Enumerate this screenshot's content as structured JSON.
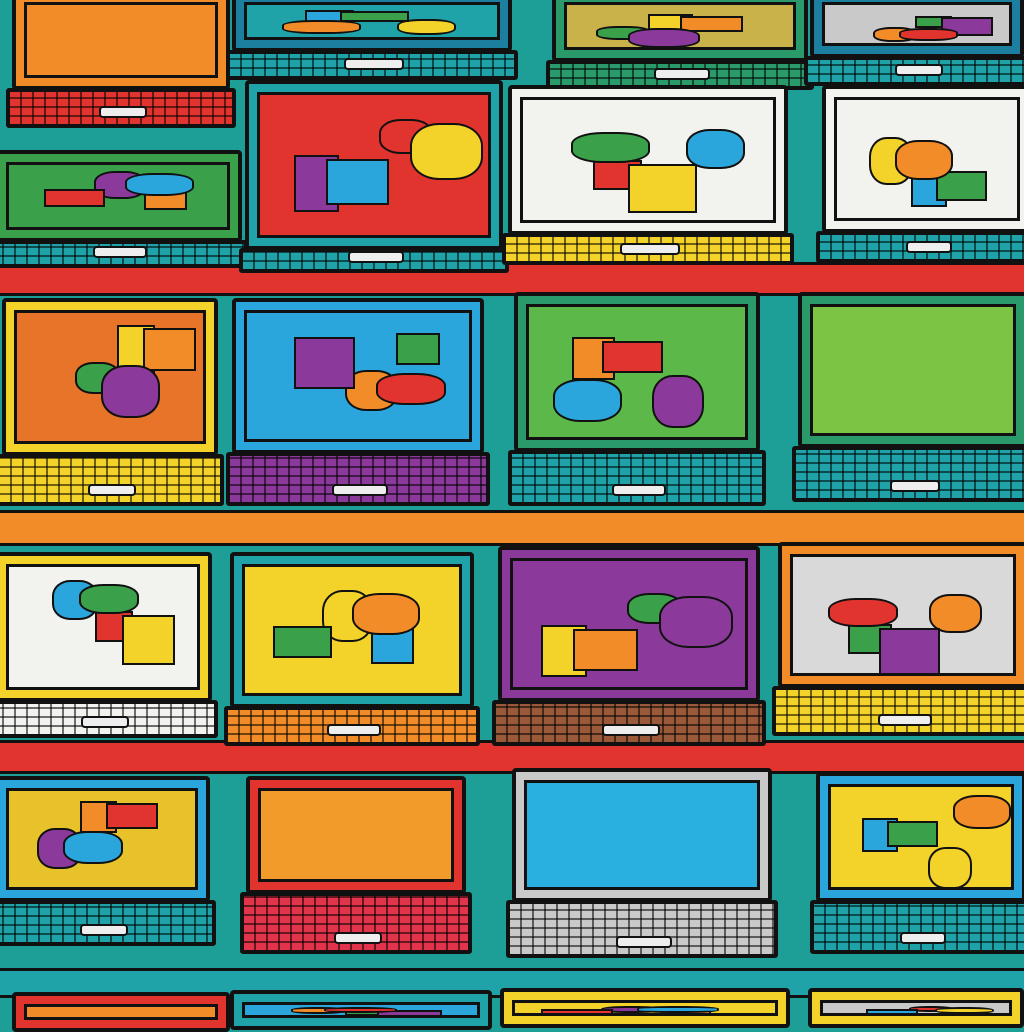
{
  "palette": {
    "background": "#1d9f98",
    "orange": "#f28c28",
    "red": "#e2342f",
    "yellow": "#f3d22a",
    "green": "#5cb848",
    "lime": "#7cc444",
    "blue": "#2aa6dc",
    "purple": "#8b3a9c",
    "teal": "#1fa3a8",
    "gray": "#c9c9c9",
    "white": "#f2f2ee"
  },
  "laptops": [
    {
      "screen": "#f28c28",
      "frame": "#f28c28",
      "body": "#e2342f",
      "art": false
    },
    {
      "screen": "#1fa3a8",
      "frame": "#1d7fa0",
      "body": "#1fa3a8",
      "art": true
    },
    {
      "screen": "#c9b24a",
      "frame": "#2a9a6a",
      "body": "#2a9a6a",
      "art": true
    },
    {
      "screen": "#c9c9c9",
      "frame": "#1d7fa0",
      "body": "#1fa3a8",
      "art": true
    },
    {
      "screen": "#3aa04a",
      "frame": "#3aa04a",
      "body": "#1fa3a8",
      "art": true
    },
    {
      "screen": "#e2342f",
      "frame": "#1fa3a8",
      "body": "#1fa3a8",
      "art": true
    },
    {
      "screen": "#f2f2ee",
      "frame": "#f2f2ee",
      "body": "#f3d22a",
      "art": true
    },
    {
      "screen": "#f2f2ee",
      "frame": "#f2f2ee",
      "body": "#1fa3a8",
      "art": true
    },
    {
      "screen": "#e8742a",
      "frame": "#f3d22a",
      "body": "#f3d22a",
      "art": true
    },
    {
      "screen": "#2aa6dc",
      "frame": "#2aa6dc",
      "body": "#8b3a9c",
      "art": true
    },
    {
      "screen": "#5cb848",
      "frame": "#2a9a6a",
      "body": "#1fa3a8",
      "art": true
    },
    {
      "screen": "#7cc444",
      "frame": "#2a9a6a",
      "body": "#1fa3a8",
      "art": false
    },
    {
      "screen": "#f2f2ee",
      "frame": "#f3d22a",
      "body": "#f2f2ee",
      "art": true
    },
    {
      "screen": "#f3d22a",
      "frame": "#1fa3a8",
      "body": "#f28c28",
      "art": true
    },
    {
      "screen": "#8b3a9c",
      "frame": "#8b3a9c",
      "body": "#9a5a3a",
      "art": true
    },
    {
      "screen": "#d9d9d9",
      "frame": "#f28c28",
      "body": "#f3d22a",
      "art": true
    },
    {
      "screen": "#e8c22a",
      "frame": "#2aa6dc",
      "body": "#1fa3a8",
      "art": true
    },
    {
      "screen": "#f29a2a",
      "frame": "#e2342f",
      "body": "#e2344a",
      "art": false
    },
    {
      "screen": "#2ab0e0",
      "frame": "#c9c9c9",
      "body": "#c9c9c9",
      "art": false
    },
    {
      "screen": "#f3d22a",
      "frame": "#2aa6dc",
      "body": "#1fa3a8",
      "art": true
    },
    {
      "screen": "#f28c28",
      "frame": "#e2342f",
      "body": "#e2342f",
      "art": false
    },
    {
      "screen": "#2aa6dc",
      "frame": "#1fa3a8",
      "body": "#1fa3a8",
      "art": true
    },
    {
      "screen": "#f3d22a",
      "frame": "#f3d22a",
      "body": "#f3d22a",
      "art": true
    },
    {
      "screen": "#c9c9c9",
      "frame": "#f3d22a",
      "body": "#f3d22a",
      "art": true
    }
  ]
}
